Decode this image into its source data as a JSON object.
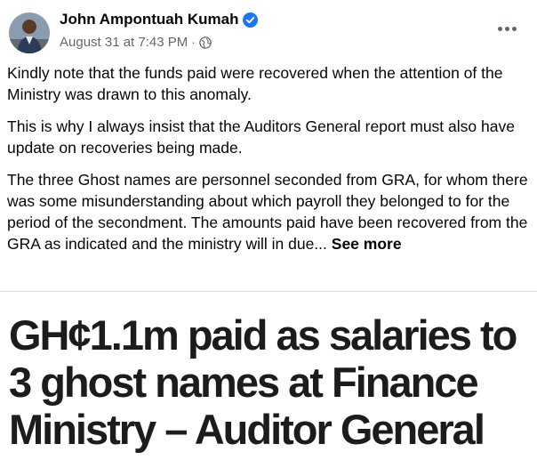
{
  "post": {
    "author": "John Ampontuah Kumah",
    "timestamp": "August 31 at 7:43 PM",
    "separator": "·",
    "paragraphs": [
      "Kindly note that the funds paid  were recovered when the attention of the Ministry was drawn to this anomaly.",
      "This is why I always insist that the Auditors General report must also have update on recoveries being made."
    ],
    "last_paragraph": "The three Ghost names are personnel seconded from GRA, for whom there was some misunderstanding about which payroll they belonged to for the period of the secondment. The amounts paid have been recovered from the GRA as indicated and the ministry will in due...",
    "see_more": "See more"
  },
  "attachment": {
    "headline": "GH¢1.1m paid as salaries to 3 ghost names at Finance Ministry – Auditor General"
  },
  "icons": {
    "verified": "verified-badge-icon",
    "audience": "globe-icon",
    "more": "more-options-icon"
  },
  "colors": {
    "verified_blue": "#1877f2",
    "meta_gray": "#65676b",
    "text": "#050505"
  }
}
